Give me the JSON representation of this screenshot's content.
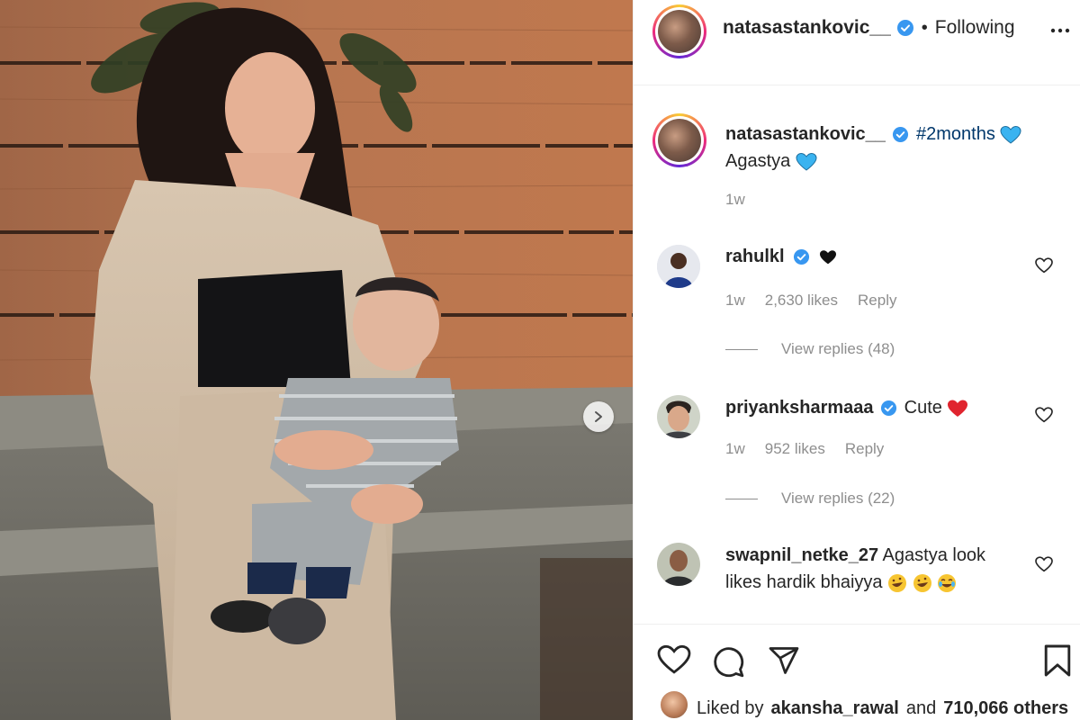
{
  "post": {
    "username": "natasastankovic__",
    "following_label": "Following",
    "separator": "•",
    "caption_hashtag": "#2months",
    "caption_text": "Agastya",
    "caption_time": "1w"
  },
  "comments": [
    {
      "username": "rahulkl",
      "verified": true,
      "text": "",
      "emoji": "black-heart",
      "time": "1w",
      "likes": "2,630 likes",
      "reply_label": "Reply",
      "view_replies": "View replies (48)"
    },
    {
      "username": "priyanksharmaaa",
      "verified": true,
      "text": "Cute",
      "emoji": "red-heart",
      "time": "1w",
      "likes": "952 likes",
      "reply_label": "Reply",
      "view_replies": "View replies (22)"
    },
    {
      "username": "swapnil_netke_27",
      "verified": false,
      "text": "Agastya look likes hardik bhaiyya",
      "emoji": "laughing-faces"
    }
  ],
  "footer": {
    "liked_by_prefix": "Liked by",
    "liked_by_user": "akansha_rawal",
    "and_label": "and",
    "others_count": "710,066 others"
  },
  "icons": {
    "like": "heart-icon",
    "comment": "comment-icon",
    "share": "share-icon",
    "save": "bookmark-icon",
    "more": "more-icon",
    "verified": "verified-badge-icon",
    "next": "chevron-right-icon"
  },
  "colors": {
    "verified_blue": "#3897f0",
    "hashtag": "#00376b",
    "meta_gray": "#8e8e8e",
    "blue_heart": "#3ab3f0",
    "red_heart": "#e0242e"
  }
}
